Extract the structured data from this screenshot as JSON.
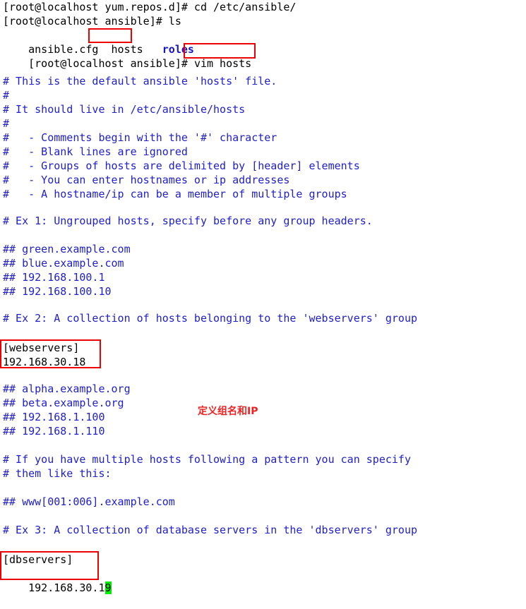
{
  "terminal": {
    "background_color": "#ffffff",
    "prompt_color": "#000000",
    "comment_color": "#2020cc",
    "directory_color": "#1414c8",
    "highlight_box_color": "#ee0000",
    "annotation_color": "#ee2222",
    "cursor_color": "#00ee00",
    "shell_lines": [
      {
        "text": "[root@localhost yum.repos.d]# cd /etc/ansible/",
        "color": "black"
      },
      {
        "text": "[root@localhost ansible]# ls",
        "color": "black"
      }
    ],
    "ls_line": {
      "file_1": "ansible.cfg",
      "gap_1": "  ",
      "file_2": "hosts",
      "gap_2": "   ",
      "dir_1": "roles"
    },
    "vim_prompt": {
      "prompt": "[root@localhost ansible]# ",
      "command": "vim hosts"
    }
  },
  "file": {
    "name": "hosts",
    "path": "/etc/ansible/hosts",
    "lines": [
      "# This is the default ansible 'hosts' file.",
      "#",
      "# It should live in /etc/ansible/hosts",
      "#",
      "#   - Comments begin with the '#' character",
      "#   - Blank lines are ignored",
      "#   - Groups of hosts are delimited by [header] elements",
      "#   - You can enter hostnames or ip addresses",
      "#   - A hostname/ip can be a member of multiple groups",
      "",
      "# Ex 1: Ungrouped hosts, specify before any group headers.",
      "",
      "## green.example.com",
      "## blue.example.com",
      "## 192.168.100.1",
      "## 192.168.100.10",
      "",
      "# Ex 2: A collection of hosts belonging to the 'webservers' group",
      "",
      "[webservers]",
      "192.168.30.18",
      "",
      "## alpha.example.org",
      "## beta.example.org",
      "## 192.168.1.100",
      "## 192.168.1.110",
      "",
      "# If you have multiple hosts following a pattern you can specify",
      "# them like this:",
      "",
      "## www[001:006].example.com",
      "",
      "# Ex 3: A collection of database servers in the 'dbservers' group",
      "",
      "[dbservers]",
      "192.168.30.19"
    ],
    "webservers_group": {
      "header": "[webservers]",
      "host": "192.168.30.18"
    },
    "dbservers_group": {
      "header": "[dbservers]",
      "host_prefix": "192.168.30.1",
      "host_cursor_char": "9"
    }
  },
  "annotations": [
    {
      "text": "定义组名和IP"
    }
  ]
}
